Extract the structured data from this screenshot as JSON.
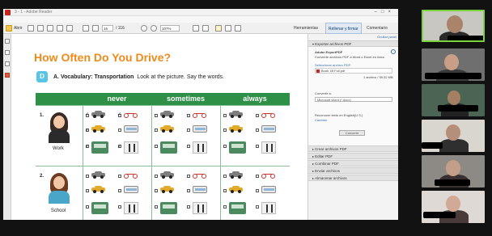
{
  "window": {
    "title": "3 - 1  -  Adobe Reader",
    "menu": [
      "Archivo",
      "Edición",
      "Ver",
      "Ventana",
      "Ayuda"
    ]
  },
  "toolbar": {
    "open_label": "Abrir",
    "page_current": "16",
    "page_total": "/ 116",
    "zoom": "107%",
    "tabs": [
      "Herramientas",
      "Rellenar y firmar",
      "Comentario"
    ],
    "active_tab": "Rellenar y firmar"
  },
  "document": {
    "title": "How Often Do You Drive?",
    "section_letter": "D",
    "vocab_prefix": "A. Vocabulary: Transportation",
    "vocab_instruction": "Look at the picture. Say the words.",
    "columns": [
      "never",
      "sometimes",
      "always"
    ],
    "rows": [
      {
        "number": "1.",
        "label": "Work"
      },
      {
        "number": "2.",
        "label": "School"
      }
    ]
  },
  "right_panel": {
    "hide_link": "Ocultar panel",
    "export_header": "Exportar archivos PDF",
    "service_name": "Adobe ExportPDF",
    "service_desc": "Convierte archivos PDF a Word o Excel en línea",
    "select_label": "Seleccionar archivo PDF:",
    "file_name": "Book 1B Full.pdf",
    "file_info": "1 archivo / 59,52 MB",
    "convert_label": "Convertir a:",
    "convert_value": "Microsoft Word (*.docx)",
    "ocr_label": "Reconocer texto en English(U.S.)",
    "ocr_link": "Cambiar",
    "convert_button": "Convertir",
    "sections": [
      "Crear archivos PDF",
      "Editar PDF",
      "Combinar PDF",
      "Enviar archivos",
      "Almacenar archivos"
    ]
  },
  "colors": {
    "title_orange": "#f08a1a",
    "header_green": "#2e8f46",
    "active_speaker": "#7dd23f"
  },
  "participants": 6
}
